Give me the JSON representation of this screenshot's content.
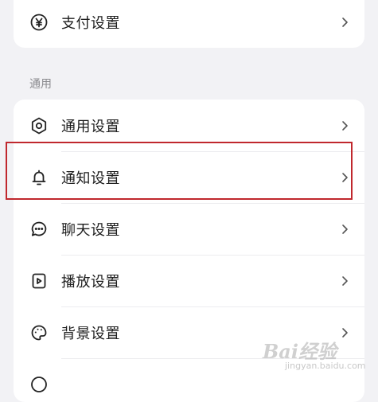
{
  "top_card": {
    "item": {
      "label": "支付设置",
      "icon": "yen-circle-icon"
    }
  },
  "section": {
    "title": "通用"
  },
  "items": [
    {
      "label": "通用设置",
      "icon": "gear-icon"
    },
    {
      "label": "通知设置",
      "icon": "bell-icon"
    },
    {
      "label": "聊天设置",
      "icon": "chat-bubble-icon"
    },
    {
      "label": "播放设置",
      "icon": "play-icon"
    },
    {
      "label": "背景设置",
      "icon": "palette-icon"
    }
  ],
  "highlighted_item": "通知设置",
  "highlight_color": "#c0282e",
  "watermark": {
    "brand": "Bai经验",
    "url": "jingyan.baidu.com"
  }
}
